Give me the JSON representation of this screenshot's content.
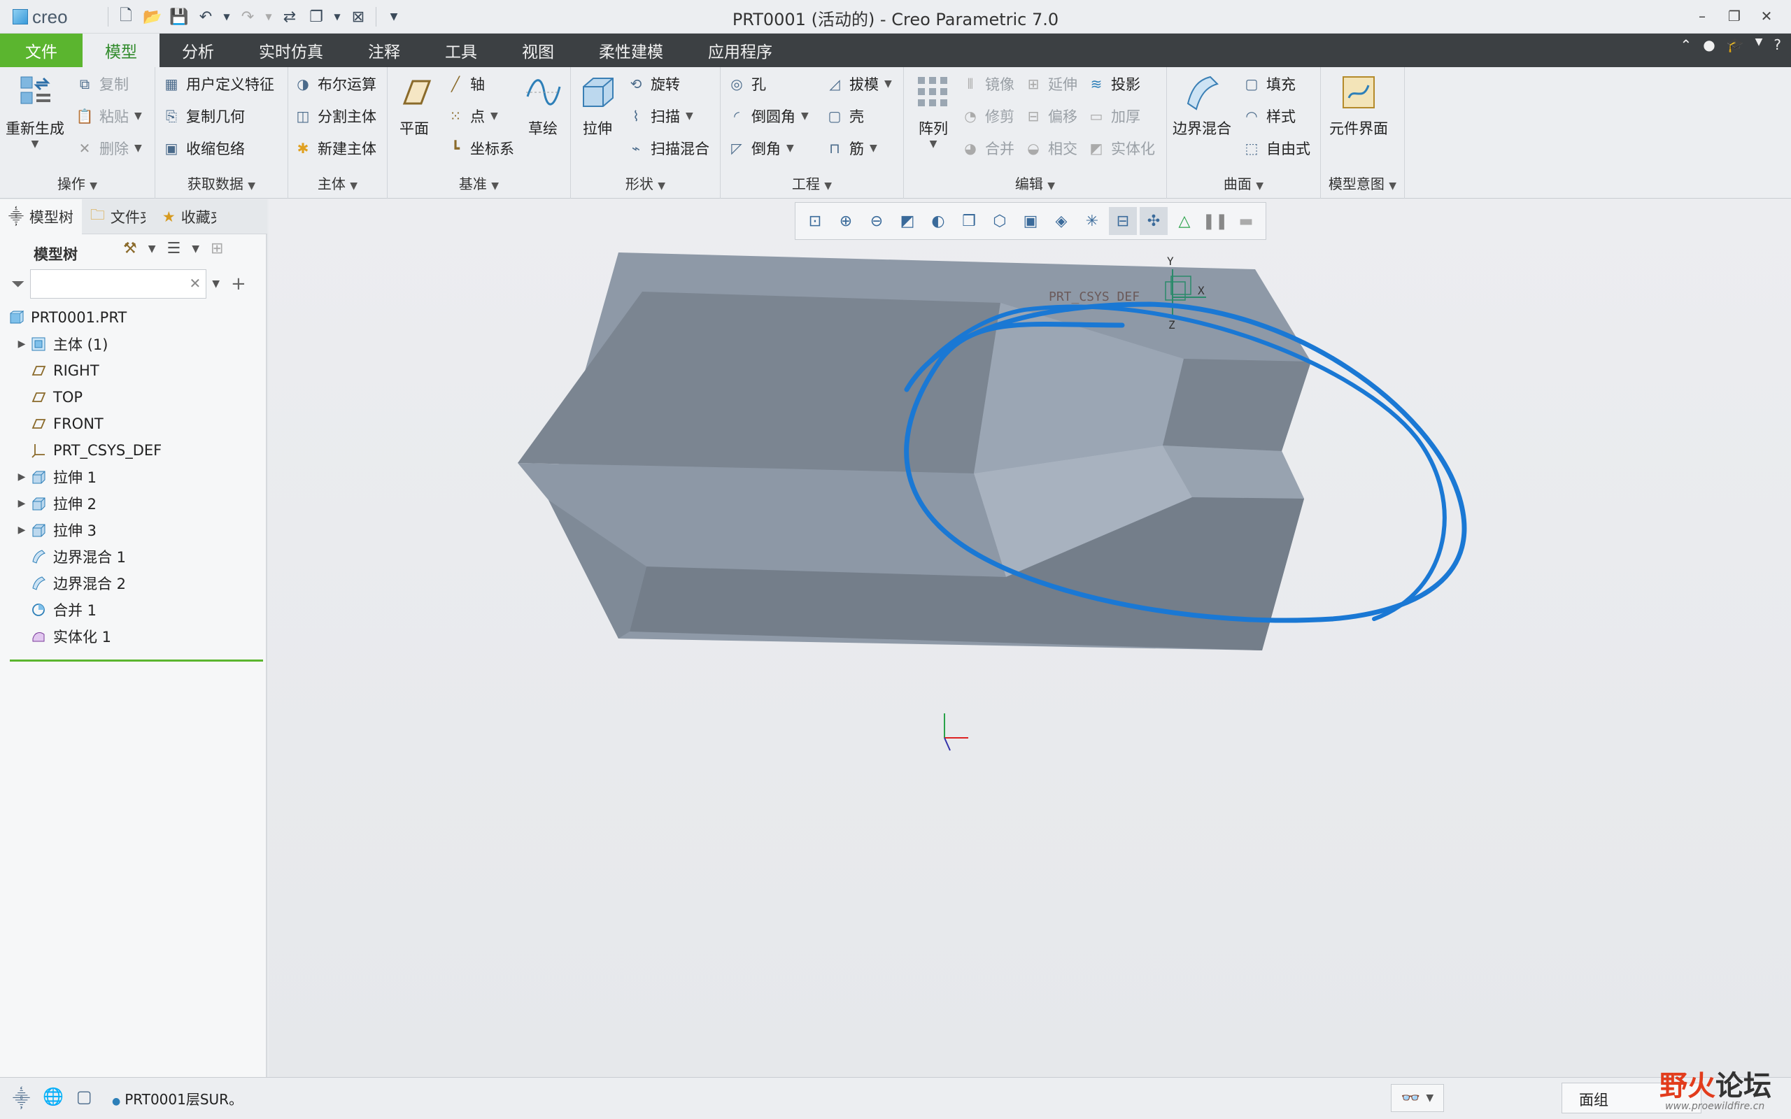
{
  "titlebar": {
    "logo": "creo",
    "title": "PRT0001 (活动的) - Creo Parametric 7.0"
  },
  "menu": {
    "tabs": [
      "文件",
      "模型",
      "分析",
      "实时仿真",
      "注释",
      "工具",
      "视图",
      "柔性建模",
      "应用程序"
    ],
    "active_tab": "模型"
  },
  "ribbon": {
    "ops": {
      "regen": "重新生成",
      "copy": "复制",
      "paste": "粘贴",
      "delete": "删除",
      "label": "操作"
    },
    "getdata": {
      "udf": "用户定义特征",
      "copygeom": "复制几何",
      "shrinkwrap": "收缩包络",
      "label": "获取数据"
    },
    "body": {
      "boolean": "布尔运算",
      "split": "分割主体",
      "newbody": "新建主体",
      "label": "主体"
    },
    "datum": {
      "plane": "平面",
      "axis": "轴",
      "point": "点",
      "csys": "坐标系",
      "sketch": "草绘",
      "label": "基准"
    },
    "shapes": {
      "extrude": "拉伸",
      "revolve": "旋转",
      "sweep": "扫描",
      "sweptblend": "扫描混合",
      "label": "形状"
    },
    "eng": {
      "hole": "孔",
      "round": "倒圆角",
      "chamfer": "倒角",
      "draft": "拔模",
      "shell": "壳",
      "rib": "筋",
      "label": "工程"
    },
    "edit": {
      "pattern": "阵列",
      "mirror": "镜像",
      "extend": "延伸",
      "project": "投影",
      "trim": "修剪",
      "offset": "偏移",
      "thicken": "加厚",
      "merge": "合并",
      "intersect": "相交",
      "solidify": "实体化",
      "label": "编辑"
    },
    "surfaces": {
      "boundary": "边界混合",
      "fill": "填充",
      "style": "样式",
      "freestyle": "自由式",
      "label": "曲面"
    },
    "intent": {
      "component": "元件界面",
      "label": "模型意图"
    }
  },
  "panel": {
    "tabs": [
      "模型树",
      "文件夹",
      "收藏夹"
    ],
    "title": "模型树",
    "search_placeholder": ""
  },
  "tree": [
    {
      "label": "PRT0001.PRT",
      "indent": 0,
      "icon": "part-icon",
      "expandable": false
    },
    {
      "label": "主体 (1)",
      "indent": 1,
      "icon": "body-icon",
      "expandable": true
    },
    {
      "label": "RIGHT",
      "indent": 1,
      "icon": "datum-plane-icon",
      "expandable": false
    },
    {
      "label": "TOP",
      "indent": 1,
      "icon": "datum-plane-icon",
      "expandable": false
    },
    {
      "label": "FRONT",
      "indent": 1,
      "icon": "datum-plane-icon",
      "expandable": false
    },
    {
      "label": "PRT_CSYS_DEF",
      "indent": 1,
      "icon": "csys-icon",
      "expandable": false
    },
    {
      "label": "拉伸 1",
      "indent": 1,
      "icon": "extrude-icon",
      "expandable": true
    },
    {
      "label": "拉伸 2",
      "indent": 1,
      "icon": "extrude-icon",
      "expandable": true
    },
    {
      "label": "拉伸 3",
      "indent": 1,
      "icon": "extrude-icon",
      "expandable": true
    },
    {
      "label": "边界混合 1",
      "indent": 1,
      "icon": "boundary-blend-icon",
      "expandable": false
    },
    {
      "label": "边界混合 2",
      "indent": 1,
      "icon": "boundary-blend-icon",
      "expandable": false
    },
    {
      "label": "合并 1",
      "indent": 1,
      "icon": "merge-icon",
      "expandable": false
    },
    {
      "label": "实体化 1",
      "indent": 1,
      "icon": "solidify-icon",
      "expandable": false
    }
  ],
  "viewport": {
    "csys_label": "PRT_CSYS_DEF",
    "axis_x": "X",
    "axis_y": "Y",
    "axis_z": "Z",
    "annotation_color": "#1a78d4"
  },
  "status": {
    "message": "PRT0001层SUR。",
    "filter": "面组",
    "brand_part1": "野火",
    "brand_part2": "论坛",
    "brand_url": "www.proewildfire.cn"
  }
}
